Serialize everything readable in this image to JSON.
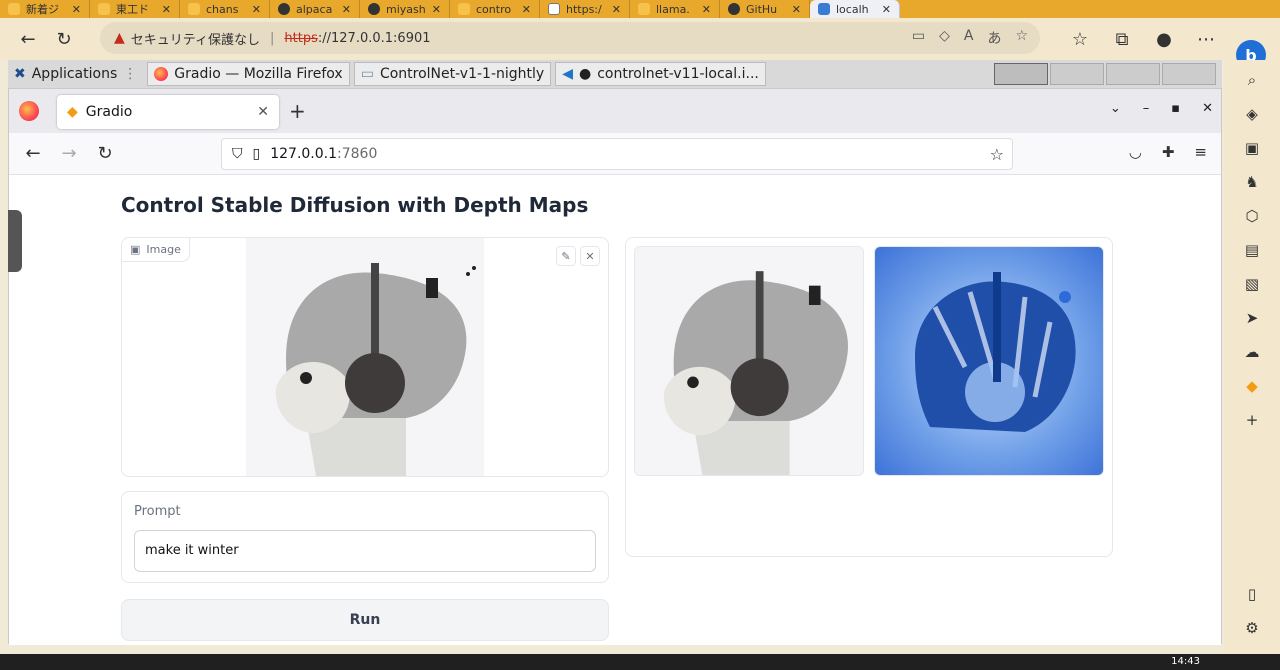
{
  "edge": {
    "tabs": [
      {
        "label": "新着ジ"
      },
      {
        "label": "東工ド"
      },
      {
        "label": "chans"
      },
      {
        "label": "alpaca"
      },
      {
        "label": "miyash"
      },
      {
        "label": "contro"
      },
      {
        "label": "https:/"
      },
      {
        "label": "llama."
      },
      {
        "label": "GitHu"
      },
      {
        "label": "localh"
      }
    ],
    "security_warning": "セキュリティ保護なし",
    "address_scheme": "https",
    "address_rest": "://127.0.0.1:6901"
  },
  "remote_bar": {
    "applications": "Applications",
    "items": [
      {
        "label": "Gradio — Mozilla Firefox"
      },
      {
        "label": "ControlNet-v1-1-nightly"
      },
      {
        "label": "controlnet-v11-local.i..."
      }
    ]
  },
  "firefox": {
    "tab_title": "Gradio",
    "url_host": "127.0.0.1",
    "url_port": ":7860"
  },
  "app": {
    "title": "Control Stable Diffusion with Depth Maps",
    "image_label": "Image",
    "prompt_label": "Prompt",
    "prompt_value": "make it winter",
    "run_label": "Run"
  },
  "taskbar": {
    "time": "14:43"
  },
  "colors": {
    "edge_tab_strip": "#e8a82c",
    "edge_toolbar": "#f3e8ce",
    "winter_blue": "#1f5fc8"
  }
}
